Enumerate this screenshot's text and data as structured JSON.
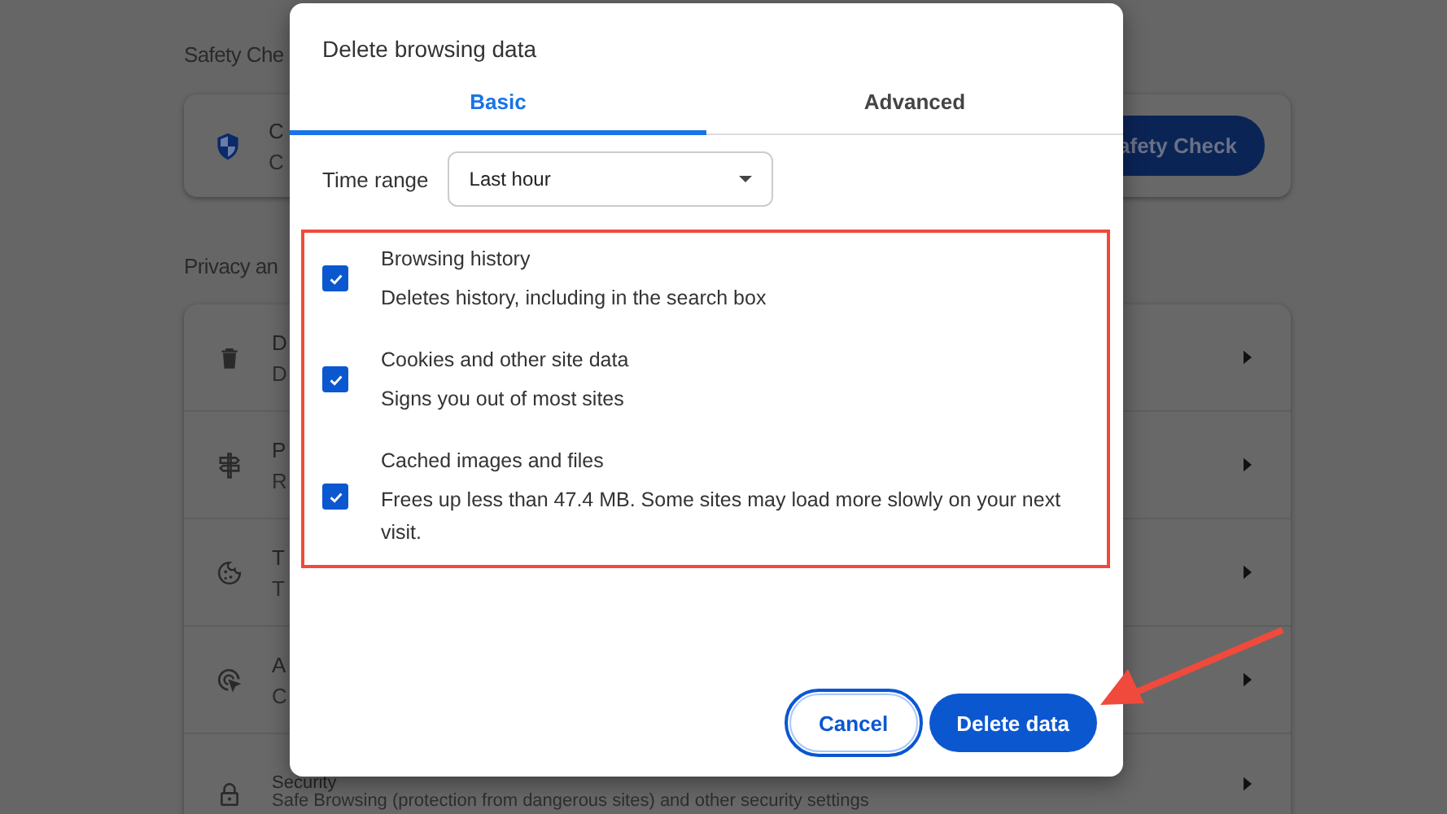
{
  "page": {
    "safety_title": "Safety Che",
    "safety_card": {
      "title": "C",
      "subtitle": "C",
      "button": "afety Check"
    },
    "privacy_title": "Privacy an",
    "rows": [
      {
        "title": "D",
        "subtitle": "D"
      },
      {
        "title": "P",
        "subtitle": "R"
      },
      {
        "title": "T",
        "subtitle": "T"
      },
      {
        "title": "A",
        "subtitle": "C"
      },
      {
        "title": "Security",
        "subtitle": "Safe Browsing (protection from dangerous sites) and other security settings"
      }
    ]
  },
  "dialog": {
    "title": "Delete browsing data",
    "tabs": [
      {
        "label": "Basic",
        "selected": true
      },
      {
        "label": "Advanced",
        "selected": false
      }
    ],
    "time_range": {
      "label": "Time range",
      "value": "Last hour"
    },
    "items": [
      {
        "title": "Browsing history",
        "description": "Deletes history, including in the search box",
        "checked": true
      },
      {
        "title": "Cookies and other site data",
        "description": "Signs you out of most sites",
        "checked": true
      },
      {
        "title": "Cached images and files",
        "description": "Frees up less than 47.4 MB. Some sites may load more slowly on your next visit.",
        "checked": true
      }
    ],
    "buttons": [
      {
        "label": "Cancel",
        "kind": "secondary",
        "focused": true
      },
      {
        "label": "Delete data",
        "kind": "primary",
        "focused": false
      }
    ]
  }
}
